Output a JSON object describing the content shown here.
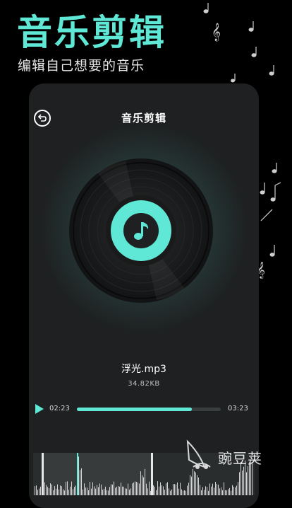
{
  "promo": {
    "title": "音乐剪辑",
    "subtitle": "编辑自己想要的音乐"
  },
  "screen": {
    "title": "音乐剪辑",
    "back_icon": "back-arrow-icon"
  },
  "track": {
    "name": "浮光.mp3",
    "size": "34.82KB",
    "current_time": "02:23",
    "total_time": "03:23",
    "progress": 0.8
  },
  "watermark": {
    "text": "豌豆荚"
  },
  "colors": {
    "accent": "#5fe8d6",
    "background": "#000000",
    "card": "#1e2021"
  }
}
